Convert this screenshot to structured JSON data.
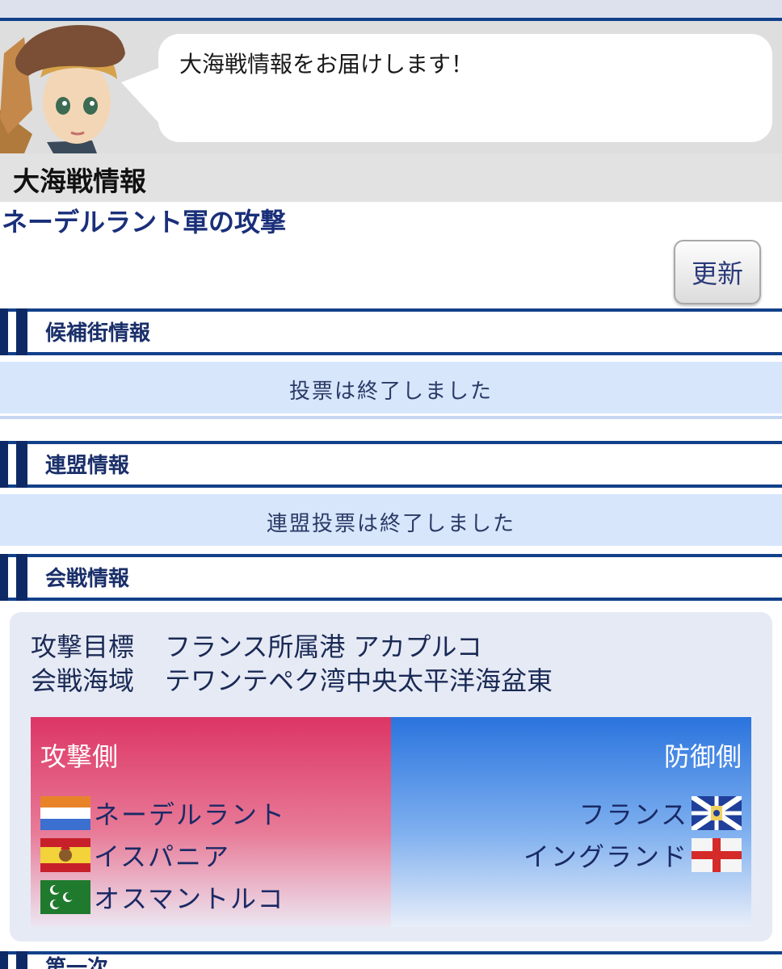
{
  "header": {
    "speech": "大海戦情報をお届けします！",
    "page_title": "大海戦情報",
    "subtitle": "ネーデルラント軍の攻撃",
    "update_label": "更新"
  },
  "sections": {
    "candidate": {
      "title": "候補街情報",
      "status": "投票は終了しました"
    },
    "alliance": {
      "title": "連盟情報",
      "status": "連盟投票は終了しました"
    },
    "battle": {
      "title": "会戦情報"
    },
    "next": {
      "title": "第一次"
    }
  },
  "battle": {
    "target_label": "攻撃目標",
    "target_value": "フランス所属港 アカプルコ",
    "area_label": "会戦海域",
    "area_value": "テワンテペク湾中央太平洋海盆東",
    "attack": {
      "title": "攻撃側",
      "nations": [
        {
          "name": "ネーデルラント",
          "flag": "netherlands-flag-icon"
        },
        {
          "name": "イスパニア",
          "flag": "spain-flag-icon"
        },
        {
          "name": "オスマントルコ",
          "flag": "ottoman-flag-icon"
        }
      ]
    },
    "defense": {
      "title": "防御側",
      "nations": [
        {
          "name": "フランス",
          "flag": "france-flag-icon"
        },
        {
          "name": "イングランド",
          "flag": "england-flag-icon"
        }
      ]
    }
  },
  "colors": {
    "navy": "#12408a",
    "attack_top": "#dc3564",
    "defense_top": "#2a74de",
    "panel_blue": "#d7e6fb"
  }
}
